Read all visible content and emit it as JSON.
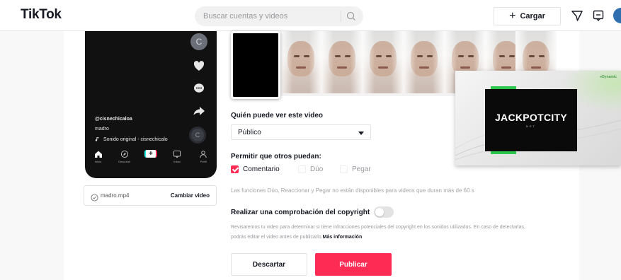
{
  "header": {
    "brand": "TikTok",
    "search_placeholder": "Buscar cuentas y videos",
    "upload_label": "Cargar"
  },
  "preview": {
    "avatar_letter": "C",
    "username": "@cisnechicaloa",
    "caption": "madro",
    "sound": "Sonido original - cisnechicalo",
    "disc_letter": "C",
    "nav": [
      "Inicio",
      "Descubrir",
      "",
      "Inbox",
      "Perfil"
    ]
  },
  "file": {
    "name": "madro.mp4",
    "change_label": "Cambiar video"
  },
  "form": {
    "who_can_view_label": "Quién puede ver este video",
    "who_can_view_value": "Público",
    "allow_label": "Permitir que otros puedan:",
    "options": [
      {
        "label": "Comentario",
        "checked": true
      },
      {
        "label": "Dúo",
        "checked": false
      },
      {
        "label": "Pegar",
        "checked": false
      }
    ],
    "options_note": "Las funciones Dúo, Reaccionar y Pegar no están disponibles para videos que duran más de 60 s",
    "copyright_label": "Realizar una comprobación del copyright",
    "copyright_desc_1": "Revisaremos tu video para determinar si tiene infracciones potenciales del copyright en los sonidos utilizados. En caso de detectarlas,",
    "copyright_desc_2": "podrás editar el video antes de publicarlo.",
    "copyright_more": "Más información",
    "discard_label": "Descartar",
    "post_label": "Publicar"
  },
  "ad": {
    "tag": "●Dynamic",
    "logo": "JACKPOTCITY",
    "logo_sub": "NET"
  },
  "colors": {
    "accent": "#fe2c55",
    "ad_green": "#2cc84d"
  }
}
